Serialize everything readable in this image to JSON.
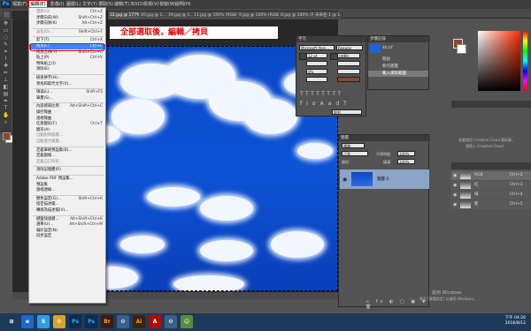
{
  "app": {
    "logo": "Ps"
  },
  "menubar": {
    "items": [
      "檔案(F)",
      "編輯(E)",
      "影像(I)",
      "圖層(L)",
      "文字(Y)",
      "選取(S)",
      "濾鏡(T)",
      "3D(D)",
      "檢視(V)",
      "視窗(W)",
      "說明(H)"
    ]
  },
  "tabs": [
    "22.jpg @ 177%...",
    "20.jpg @ 1...",
    "19.jpg @ 1...",
    "11.jpg @ 100% (RGB/8...",
    "9.jpg @ 100% (RGB/8...",
    "8.jpg @ 100% (RG...",
    "未命名-1 @ 1..."
  ],
  "annotation": {
    "text": "全部選取後，編輯／拷貝"
  },
  "edit_menu": {
    "rows": [
      {
        "label": "還原(O)",
        "shortcut": "Ctrl+Z",
        "disabled": true
      },
      {
        "label": "步驟向前(W)",
        "shortcut": "Shift+Ctrl+Z",
        "disabled": false
      },
      {
        "label": "步驟向後(K)",
        "shortcut": "Alt+Ctrl+Z",
        "disabled": false
      },
      {
        "sep": true
      },
      {
        "label": "淡化(D)...",
        "shortcut": "Shift+Ctrl+F",
        "disabled": true
      },
      {
        "sep": true
      },
      {
        "label": "剪下(T)",
        "shortcut": "Ctrl+X",
        "disabled": false
      },
      {
        "label": "拷貝(C)",
        "shortcut": "Ctrl+C",
        "disabled": false,
        "highlight": true
      },
      {
        "label": "拷貝合併(Y)",
        "shortcut": "Shift+Ctrl+C",
        "disabled": false
      },
      {
        "label": "貼上(P)",
        "shortcut": "Ctrl+V",
        "disabled": false
      },
      {
        "label": "特殊貼上(I)",
        "shortcut": "",
        "disabled": false
      },
      {
        "label": "清除(E)",
        "shortcut": "",
        "disabled": false
      },
      {
        "sep": true
      },
      {
        "label": "檢查拼字(H)...",
        "shortcut": "",
        "disabled": false
      },
      {
        "label": "尋找和取代文字(X)...",
        "shortcut": "",
        "disabled": false
      },
      {
        "sep": true
      },
      {
        "label": "填滿(L)...",
        "shortcut": "Shift+F5",
        "disabled": false
      },
      {
        "label": "筆畫(S)...",
        "shortcut": "",
        "disabled": false
      },
      {
        "sep": true
      },
      {
        "label": "內容感知比例",
        "shortcut": "Alt+Shift+Ctrl+C",
        "disabled": false
      },
      {
        "label": "操控彎曲",
        "shortcut": "",
        "disabled": false
      },
      {
        "label": "透視彎曲",
        "shortcut": "",
        "disabled": false
      },
      {
        "label": "任意變形(F)",
        "shortcut": "Ctrl+T",
        "disabled": false
      },
      {
        "label": "變形(A)",
        "shortcut": "",
        "disabled": false
      },
      {
        "label": "自動對齊圖層...",
        "shortcut": "",
        "disabled": true
      },
      {
        "label": "自動混合圖層...",
        "shortcut": "",
        "disabled": true
      },
      {
        "sep": true
      },
      {
        "label": "定義筆刷預設集(B)...",
        "shortcut": "",
        "disabled": false
      },
      {
        "label": "定義圖樣...",
        "shortcut": "",
        "disabled": false
      },
      {
        "label": "定義自訂形狀...",
        "shortcut": "",
        "disabled": true
      },
      {
        "sep": true
      },
      {
        "label": "清除記憶體(R)",
        "shortcut": "",
        "disabled": false
      },
      {
        "sep": true
      },
      {
        "label": "Adobe PDF 預設集...",
        "shortcut": "",
        "disabled": false
      },
      {
        "label": "預設集",
        "shortcut": "",
        "disabled": false
      },
      {
        "label": "遠端連線...",
        "shortcut": "",
        "disabled": false
      },
      {
        "sep": true
      },
      {
        "label": "顏色設定(G)...",
        "shortcut": "Shift+Ctrl+K",
        "disabled": false
      },
      {
        "label": "指定描述檔...",
        "shortcut": "",
        "disabled": false
      },
      {
        "label": "轉換為描述檔(V)...",
        "shortcut": "",
        "disabled": false
      },
      {
        "sep": true
      },
      {
        "label": "鍵盤快速鍵...",
        "shortcut": "Alt+Shift+Ctrl+K",
        "disabled": false
      },
      {
        "label": "選單(U)...",
        "shortcut": "Alt+Shift+Ctrl+M",
        "disabled": false
      },
      {
        "label": "偏好設定(N)",
        "shortcut": "",
        "disabled": false
      },
      {
        "label": "同步設定",
        "shortcut": "",
        "disabled": false
      }
    ]
  },
  "char_panel": {
    "title": "字元",
    "font": "Microsoft Jhen...",
    "style": "Regular",
    "size": "12 pt",
    "leading": "(自動)",
    "tracking": "0%",
    "aa": "銳利"
  },
  "history_panel": {
    "title": "步驟記錄",
    "file": "4b.tif",
    "items": [
      "開啟",
      "製作圖層",
      "載入選取範圍"
    ]
  },
  "layers_panel": {
    "title": "圖層",
    "kind": "種類",
    "blend": "正常",
    "opacity_label": "不透明度:",
    "opacity": "100%",
    "lock_label": "鎖定:",
    "fill_label": "填滿:",
    "fill": "100%",
    "layer_name": "圖層 0"
  },
  "channels": [
    {
      "name": "RGB",
      "shortcut": "Ctrl+2"
    },
    {
      "name": "紅",
      "shortcut": "Ctrl+3"
    },
    {
      "name": "綠",
      "shortcut": "Ctrl+4"
    },
    {
      "name": "藍",
      "shortcut": "Ctrl+5"
    }
  ],
  "libraries": {
    "line1": "若要使用 Creative Cloud 資料庫，",
    "line2": "請登入 Creative Cloud"
  },
  "watermark": {
    "line1": "啟用 Windows",
    "line2": "移至 [電腦設定] 以啟用 Windows。"
  },
  "clock": {
    "time": "下午 04:26",
    "date": "2016/8/12"
  },
  "taskbar": [
    "e",
    "S",
    "⚙",
    "Ps",
    "Ps",
    "Br",
    "⚙",
    "Ai",
    "A",
    "⚙",
    "☺"
  ],
  "colors": {
    "accent": "#3a86ff",
    "annotation": "#e60000",
    "fg": "#8a4a2a",
    "bg": "#ffffff"
  }
}
